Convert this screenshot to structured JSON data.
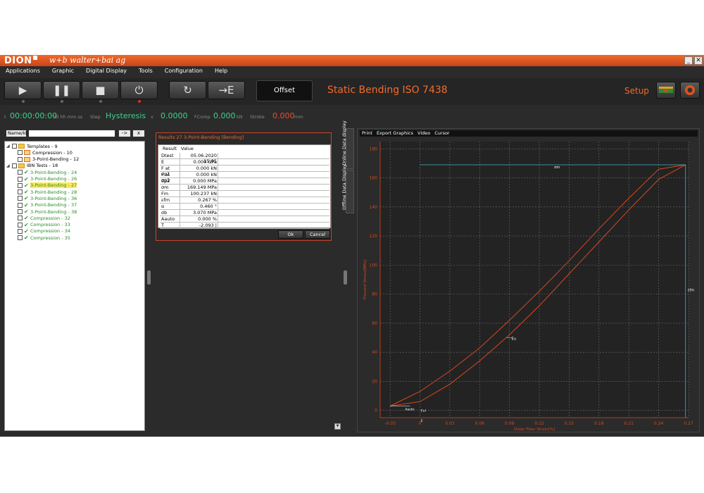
{
  "window": {
    "logo": "DION",
    "company": "w+b walter+bai ag",
    "minimize": "_",
    "close": "✕"
  },
  "menu": [
    "Applications",
    "Graphic",
    "Digital Display",
    "Tools",
    "Configuration",
    "Help"
  ],
  "toolbar": {
    "offset_label": "Offset",
    "test_title": "Static Bending ISO 7438",
    "setup_label": "Setup",
    "buttons": [
      "play-icon",
      "pause-icon",
      "stop-icon",
      "power-icon",
      "reset-icon",
      "approach-icon"
    ]
  },
  "status": {
    "time_prefix": "t",
    "time_value": "00:00:00:00",
    "time_unit": "dd hh mm ss",
    "step_label": "Step",
    "step_value": "Hysteresis",
    "v_label": "v",
    "v_value": "0.0000",
    "fcomp_label": "FComp",
    "fcomp_value": "0.000",
    "fcomp_unit": "kN",
    "stroke_label": "Stroke",
    "stroke_value": "0.000",
    "stroke_unit": "mm"
  },
  "search": {
    "label": "Name/Id",
    "value": "",
    "go_label": "->",
    "clear_label": "x"
  },
  "tree": [
    {
      "label": "Templates - 9",
      "kind": "folder",
      "level": 0,
      "state": "expanded"
    },
    {
      "label": "Compression - 10",
      "kind": "template",
      "level": 1
    },
    {
      "label": "3-Point-Bending - 12",
      "kind": "template",
      "level": 1
    },
    {
      "label": "IBN Tests - 18",
      "kind": "folder",
      "level": 0,
      "state": "expanded"
    },
    {
      "label": "3-Point-Bending - 24",
      "kind": "test",
      "level": 1
    },
    {
      "label": "3-Point-Bending - 26",
      "kind": "test",
      "level": 1
    },
    {
      "label": "3-Point-Bending - 27",
      "kind": "test",
      "level": 1,
      "selected": true
    },
    {
      "label": "3-Point-Bending - 28",
      "kind": "test",
      "level": 1
    },
    {
      "label": "3-Point-Bending - 36",
      "kind": "test",
      "level": 1
    },
    {
      "label": "3-Point-Bending - 37",
      "kind": "test",
      "level": 1
    },
    {
      "label": "3-Point-Bending - 38",
      "kind": "test",
      "level": 1
    },
    {
      "label": "Compression - 32",
      "kind": "test",
      "level": 1
    },
    {
      "label": "Compression - 33",
      "kind": "test",
      "level": 1
    },
    {
      "label": "Compression - 34",
      "kind": "test",
      "level": 1
    },
    {
      "label": "Compression - 35",
      "kind": "test",
      "level": 1
    }
  ],
  "results": {
    "title": "Results 27 3-Point-Bending [Bending]",
    "col_result": "Result",
    "col_value": "Value",
    "rows": [
      {
        "name": "Dtest",
        "value": "05.06.2020 15:05"
      },
      {
        "name": "E",
        "value": "0.000 GPa"
      },
      {
        "name": "F at σp1",
        "value": "0.000 kN"
      },
      {
        "name": "F at σp2",
        "value": "0.000 kN"
      },
      {
        "name": "σp2",
        "value": "0.000 MPa"
      },
      {
        "name": "σm",
        "value": "169.149 MPa"
      },
      {
        "name": "Fm",
        "value": "100.237 kN"
      },
      {
        "name": "εfm",
        "value": "0.267 %"
      },
      {
        "name": "α",
        "value": "0.460 °"
      },
      {
        "name": "σb",
        "value": "3.070 MPa"
      },
      {
        "name": "Aauto",
        "value": "0.000 %"
      },
      {
        "name": "T",
        "value": "-2.093 |"
      }
    ],
    "ok_label": "Ok",
    "cancel_label": "Cancel"
  },
  "side_tabs": {
    "online": "Online Data display",
    "offline": "Offline Data Display"
  },
  "chart_menu": [
    "Print",
    "Export Graphics",
    "Video",
    "Cursor"
  ],
  "chart_data": {
    "type": "line",
    "xlabel": "Outer Fiber Strain[%]",
    "ylabel": "Flexural Stress[MPa]",
    "xlim": [
      -0.04,
      0.27
    ],
    "ylim": [
      -5,
      185
    ],
    "xticks": [
      -0.03,
      0,
      0.03,
      0.06,
      0.09,
      0.12,
      0.15,
      0.18,
      0.21,
      0.24,
      0.27
    ],
    "xtick_labels": [
      "-0.03",
      "0",
      "0.03",
      "0.06",
      "0.09",
      "0.12",
      "0.15",
      "0.18",
      "0.21",
      "0.24",
      "0.27"
    ],
    "yticks": [
      0,
      20,
      40,
      60,
      80,
      100,
      120,
      140,
      160,
      180
    ],
    "grid": true,
    "colors": {
      "curve": "#d6481e",
      "marker": "#3fb9c9",
      "axis": "#d6481e",
      "grid": "#6a6a6a",
      "bg": "#232323"
    },
    "series": [
      {
        "x": [
          -0.03,
          0,
          0.03,
          0.06,
          0.09,
          0.12,
          0.15,
          0.18,
          0.21,
          0.24,
          0.267
        ],
        "y": [
          3,
          13,
          27,
          43,
          62,
          82,
          103,
          125,
          146,
          166,
          169
        ]
      },
      {
        "x": [
          -0.03,
          0,
          0.03,
          0.06,
          0.09,
          0.12,
          0.15,
          0.18,
          0.21,
          0.24,
          0.267
        ],
        "y": [
          3,
          6,
          18,
          34,
          52,
          72,
          94,
          116,
          138,
          159,
          169
        ]
      }
    ],
    "markers": {
      "sigma_m_label": "σm",
      "sigma_m": 169,
      "eps_fm_label": "εfm",
      "eps_fm": 0.267,
      "eu_label": "Eu",
      "eu": [
        0.09,
        50
      ],
      "e_label": "E",
      "aauto_label": "Aauto",
      "eul_label": "Eul"
    }
  }
}
